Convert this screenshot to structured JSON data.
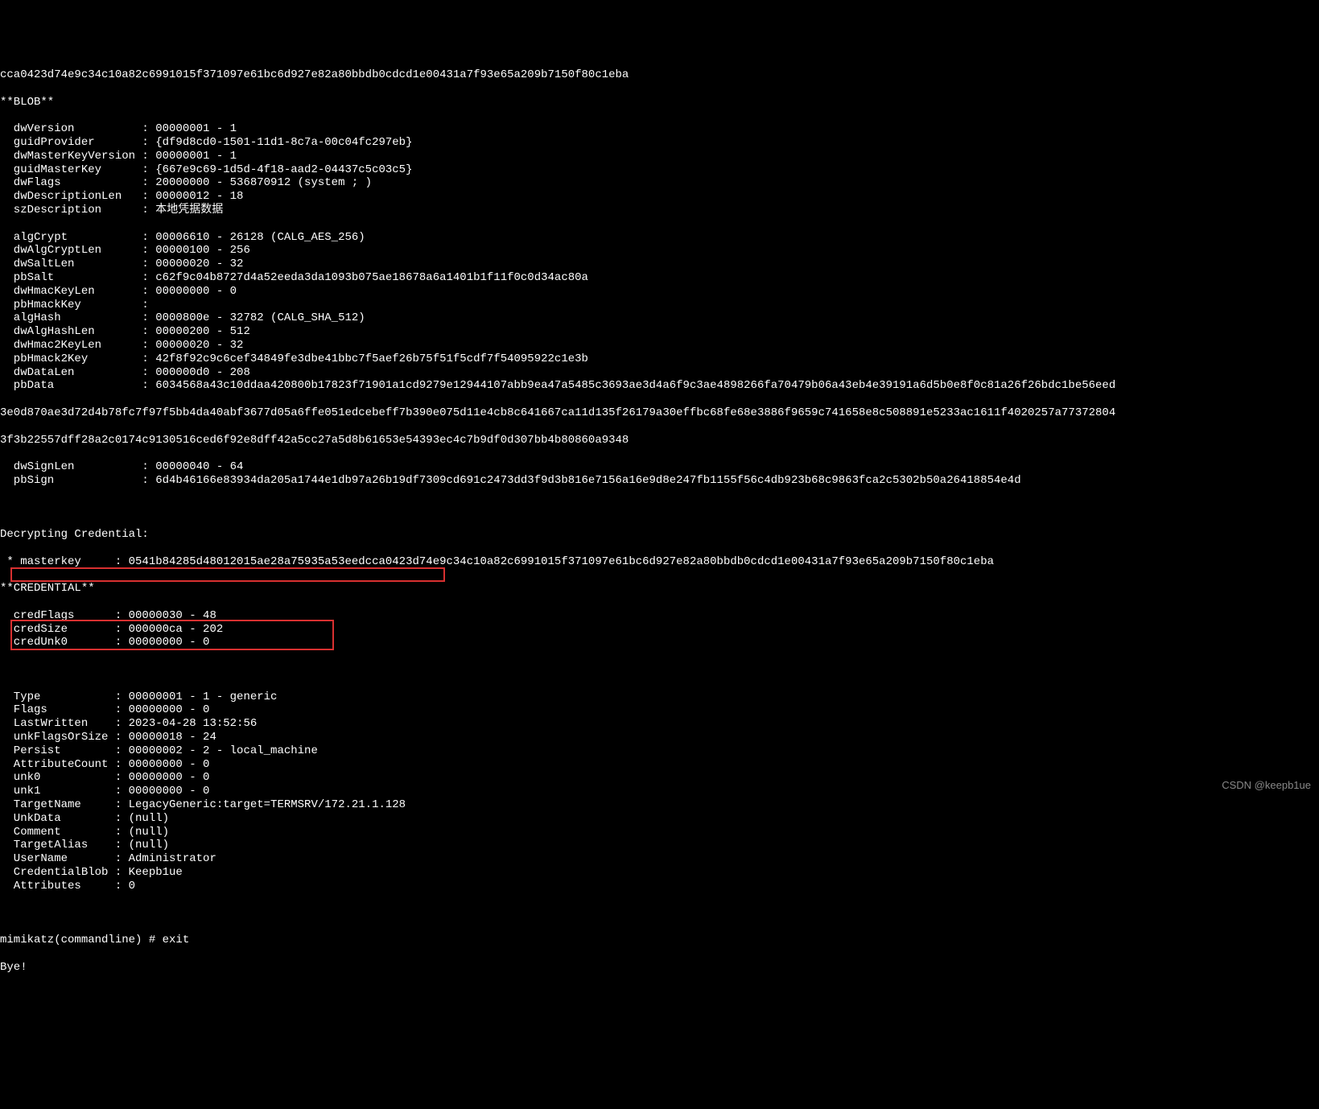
{
  "hash_top": "cca0423d74e9c34c10a82c6991015f371097e61bc6d927e82a80bbdb0cdcd1e00431a7f93e65a209b7150f80c1eba",
  "blob_header": "**BLOB**",
  "blob": [
    {
      "key": "  dwVersion",
      "pad": "          ",
      "val": "00000001 - 1"
    },
    {
      "key": "  guidProvider",
      "pad": "       ",
      "val": "{df9d8cd0-1501-11d1-8c7a-00c04fc297eb}"
    },
    {
      "key": "  dwMasterKeyVersion",
      "pad": " ",
      "val": "00000001 - 1"
    },
    {
      "key": "  guidMasterKey",
      "pad": "      ",
      "val": "{667e9c69-1d5d-4f18-aad2-04437c5c03c5}"
    },
    {
      "key": "  dwFlags",
      "pad": "            ",
      "val": "20000000 - 536870912 (system ; )"
    },
    {
      "key": "  dwDescriptionLen",
      "pad": "   ",
      "val": "00000012 - 18"
    },
    {
      "key": "  szDescription",
      "pad": "      ",
      "val": "本地凭据数据"
    },
    {
      "key": "",
      "pad": "",
      "val": ""
    },
    {
      "key": "  algCrypt",
      "pad": "           ",
      "val": "00006610 - 26128 (CALG_AES_256)"
    },
    {
      "key": "  dwAlgCryptLen",
      "pad": "      ",
      "val": "00000100 - 256"
    },
    {
      "key": "  dwSaltLen",
      "pad": "          ",
      "val": "00000020 - 32"
    },
    {
      "key": "  pbSalt",
      "pad": "             ",
      "val": "c62f9c04b8727d4a52eeda3da1093b075ae18678a6a1401b1f11f0c0d34ac80a"
    },
    {
      "key": "  dwHmacKeyLen",
      "pad": "       ",
      "val": "00000000 - 0"
    },
    {
      "key": "  pbHmackKey",
      "pad": "         ",
      "val": ""
    },
    {
      "key": "  algHash",
      "pad": "            ",
      "val": "0000800e - 32782 (CALG_SHA_512)"
    },
    {
      "key": "  dwAlgHashLen",
      "pad": "       ",
      "val": "00000200 - 512"
    },
    {
      "key": "  dwHmac2KeyLen",
      "pad": "      ",
      "val": "00000020 - 32"
    },
    {
      "key": "  pbHmack2Key",
      "pad": "        ",
      "val": "42f8f92c9c6cef34849fe3dbe41bbc7f5aef26b75f51f5cdf7f54095922c1e3b"
    },
    {
      "key": "  dwDataLen",
      "pad": "          ",
      "val": "000000d0 - 208"
    },
    {
      "key": "  pbData",
      "pad": "             ",
      "val": "6034568a43c10ddaa420800b17823f71901a1cd9279e12944107abb9ea47a5485c3693ae3d4a6f9c3ae4898266fa70479b06a43eb4e39191a6d5b0e8f0c81a26f26bdc1be56eed"
    }
  ],
  "pbdata_cont1": "3e0d870ae3d72d4b78fc7f97f5bb4da40abf3677d05a6ffe051edcebeff7b390e075d11e4cb8c641667ca11d135f26179a30effbc68fe68e3886f9659c741658e8c508891e5233ac1611f4020257a77372804",
  "pbdata_cont2": "3f3b22557dff28a2c0174c9130516ced6f92e8dff42a5cc27a5d8b61653e54393ec4c7b9df0d307bb4b80860a9348",
  "blob2": [
    {
      "key": "  dwSignLen",
      "pad": "          ",
      "val": "00000040 - 64"
    },
    {
      "key": "  pbSign",
      "pad": "             ",
      "val": "6d4b46166e83934da205a1744e1db97a26b19df7309cd691c2473dd3f9d3b816e7156a16e9d8e247fb1155f56c4db923b68c9863fca2c5302b50a26418854e4d"
    }
  ],
  "decrypting": "Decrypting Credential:",
  "masterkey_line": " * masterkey     : 0541b84285d48012015ae28a75935a53eedcca0423d74e9c34c10a82c6991015f371097e61bc6d927e82a80bbdb0cdcd1e00431a7f93e65a209b7150f80c1eba",
  "cred_header": "**CREDENTIAL**",
  "cred1": [
    {
      "key": "  credFlags",
      "pad": "      ",
      "val": "00000030 - 48"
    },
    {
      "key": "  credSize",
      "pad": "       ",
      "val": "000000ca - 202"
    },
    {
      "key": "  credUnk0",
      "pad": "       ",
      "val": "00000000 - 0"
    }
  ],
  "cred2": [
    {
      "key": "  Type",
      "pad": "           ",
      "val": "00000001 - 1 - generic"
    },
    {
      "key": "  Flags",
      "pad": "          ",
      "val": "00000000 - 0"
    },
    {
      "key": "  LastWritten",
      "pad": "    ",
      "val": "2023-04-28 13:52:56"
    },
    {
      "key": "  unkFlagsOrSize",
      "pad": " ",
      "val": "00000018 - 24"
    },
    {
      "key": "  Persist",
      "pad": "        ",
      "val": "00000002 - 2 - local_machine"
    },
    {
      "key": "  AttributeCount",
      "pad": " ",
      "val": "00000000 - 0"
    },
    {
      "key": "  unk0",
      "pad": "           ",
      "val": "00000000 - 0"
    },
    {
      "key": "  unk1",
      "pad": "           ",
      "val": "00000000 - 0"
    },
    {
      "key": "  TargetName",
      "pad": "     ",
      "val": "LegacyGeneric:target=TERMSRV/172.21.1.128"
    },
    {
      "key": "  UnkData",
      "pad": "        ",
      "val": "(null)"
    },
    {
      "key": "  Comment",
      "pad": "        ",
      "val": "(null)"
    },
    {
      "key": "  TargetAlias",
      "pad": "    ",
      "val": "(null)"
    },
    {
      "key": "  UserName",
      "pad": "       ",
      "val": "Administrator"
    },
    {
      "key": "  CredentialBlob",
      "pad": " ",
      "val": "Keepb1ue"
    },
    {
      "key": "  Attributes",
      "pad": "     ",
      "val": "0"
    }
  ],
  "prompt": "mimikatz(commandline) # exit",
  "bye": "Bye!",
  "watermark": "CSDN @keepb1ue"
}
